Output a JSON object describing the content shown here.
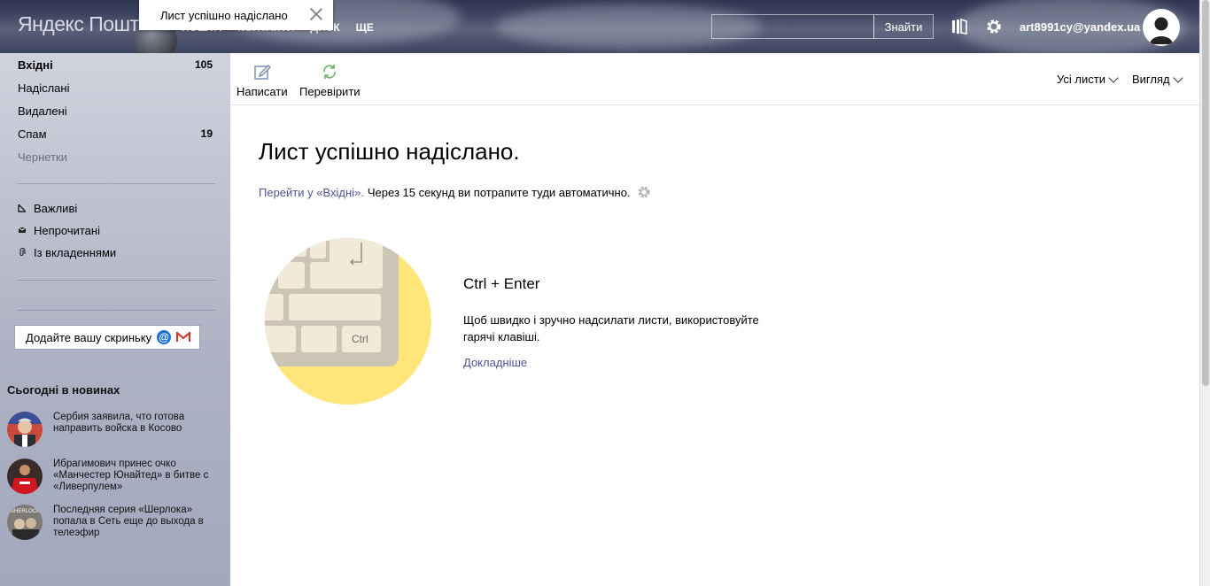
{
  "header": {
    "logo_brand": "Яндекс",
    "logo_product": "Пошта",
    "nav": [
      "Пошта",
      "Контакти",
      "Диск",
      "Ще"
    ],
    "search_placeholder": "",
    "search_button": "Знайти",
    "user_email": "art8991cy@yandex.ua"
  },
  "toast": {
    "text": "Лист успішно надіслано"
  },
  "sidebar": {
    "folders": [
      {
        "name": "Вхідні",
        "count": "105"
      },
      {
        "name": "Надіслані",
        "count": ""
      },
      {
        "name": "Видалені",
        "count": ""
      },
      {
        "name": "Спам",
        "count": "19"
      },
      {
        "name": "Чернетки",
        "count": ""
      }
    ],
    "filters": [
      {
        "label": "Важливі",
        "icon": "important-icon"
      },
      {
        "label": "Непрочитані",
        "icon": "unread-icon"
      },
      {
        "label": "Із вкладеннями",
        "icon": "attachment-icon"
      }
    ],
    "add_mailbox": "Додайте вашу скриньку",
    "news_title": "Сьогодні в новинах",
    "news": [
      {
        "text": "Сербия заявила, что готова направить войска в Косово"
      },
      {
        "text": "Ибрагимович принес очко «Манчестер Юнайтед» в битве с «Ливерпулем»"
      },
      {
        "text": "Последняя серия «Шерлока» попала в Сеть еще до выхода в телеэфир",
        "thumb_label": "SHERLOCK"
      }
    ]
  },
  "toolbar": {
    "compose": "Написати",
    "check": "Перевірити",
    "all_letters": "Усі листи",
    "view": "Вигляд"
  },
  "main": {
    "title": "Лист успішно надіслано.",
    "redirect_link": "Перейти у «Вхідні».",
    "redirect_text": "Через 15 секунд ви потрапите туди автоматично.",
    "hotkey_title": "Ctrl + Enter",
    "hotkey_desc": "Щоб швидко і зручно надсилати листи, використовуйте гарячі клавіші.",
    "more_link": "Докладніше",
    "key_label": "Ctrl"
  },
  "colors": {
    "link": "#4f5596",
    "yellow_circle": "#ffe57a",
    "keyboard_body": "#ccc5b5",
    "key_fill": "#f2ead8"
  }
}
